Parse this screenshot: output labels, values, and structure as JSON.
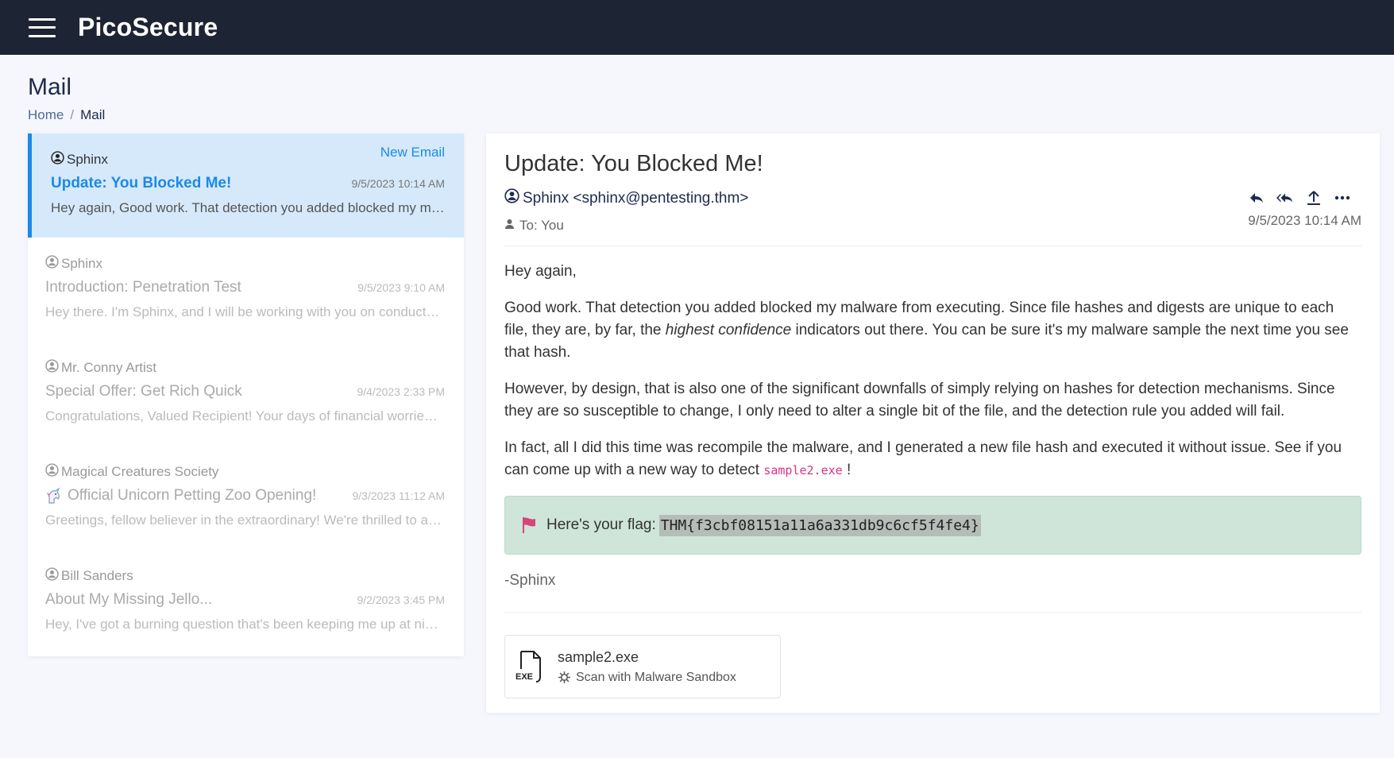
{
  "app": {
    "brand": "PicoSecure"
  },
  "page": {
    "title": "Mail"
  },
  "breadcrumb": {
    "home": "Home",
    "current": "Mail",
    "separator": "/"
  },
  "mail_list": [
    {
      "sender": "Sphinx",
      "subject": "Update: You Blocked Me!",
      "date": "9/5/2023 10:14 AM",
      "preview": "Hey again, Good work. That detection you added blocked my malware from executing.",
      "badge": "New Email",
      "active": true
    },
    {
      "sender": "Sphinx",
      "subject": "Introduction: Penetration Test",
      "date": "9/5/2023 9:10 AM",
      "preview": "Hey there. I'm Sphinx, and I will be working with you on conducting a penetration test.",
      "badge": "",
      "active": false
    },
    {
      "sender": "Mr. Conny Artist",
      "subject": "Special Offer: Get Rich Quick",
      "date": "9/4/2023 2:33 PM",
      "preview": "Congratulations, Valued Recipient! Your days of financial worries are over.",
      "badge": "",
      "active": false
    },
    {
      "sender": "Magical Creatures Society",
      "subject": "Official Unicorn Petting Zoo Opening!",
      "date": "9/3/2023 11:12 AM",
      "preview": "Greetings, fellow believer in the extraordinary! We're thrilled to announce the opening.",
      "badge": "",
      "active": false,
      "icon": "unicorn-icon"
    },
    {
      "sender": "Bill Sanders",
      "subject": "About My Missing Jello...",
      "date": "9/2/2023 3:45 PM",
      "preview": "Hey, I've got a burning question that's been keeping me up at night.",
      "badge": "",
      "active": false
    }
  ],
  "reader": {
    "subject": "Update: You Blocked Me!",
    "from": "Sphinx <sphinx@pentesting.thm>",
    "to": "To: You",
    "date": "9/5/2023 10:14 AM",
    "greeting": "Hey again,",
    "p1_a": "Good work. That detection you added blocked my malware from executing. Since file hashes and digests are unique to each file, they are, by far, the ",
    "p1_em": "highest confidence",
    "p1_b": " indicators out there. You can be sure it's my malware sample the next time you see that hash.",
    "p2": "However, by design, that is also one of the significant downfalls of simply relying on hashes for detection mechanisms. Since they are so susceptible to change, I only need to alter a single bit of the file, and the detection rule you added will fail.",
    "p3_a": "In fact, all I did this time was recompile the malware, and I generated a new file hash and executed it without issue. See if you can come up with a new way to detect ",
    "p3_code": "sample2.exe",
    "p3_b": " !",
    "flag_label": "Here's your flag:",
    "flag_value": "THM{f3cbf08151a11a6a331db9c6cf5f4fe4}",
    "signature": "-Sphinx",
    "attachment": {
      "name": "sample2.exe",
      "action": "Scan with Malware Sandbox",
      "file_type": "EXE"
    }
  },
  "colors": {
    "topbar": "#1d2433",
    "accent": "#1c89e8",
    "flag_bg": "#cfe5da",
    "flag_icon": "#d8457a",
    "action_icons": "#1c2a4d"
  }
}
